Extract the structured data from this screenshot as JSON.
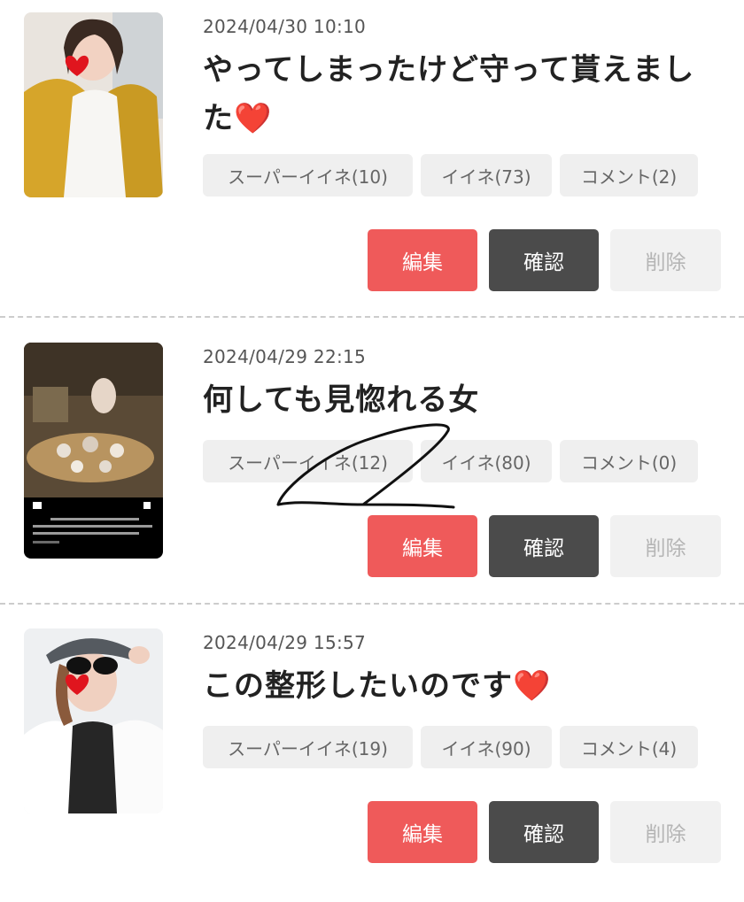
{
  "posts": [
    {
      "date": "2024/04/30 10:10",
      "title": "やってしまったけど守って貰えました",
      "title_emoji": "❤️",
      "super_like": "スーパーイイネ(10)",
      "like": "イイネ(73)",
      "comment": "コメント(2)",
      "edit_label": "編集",
      "confirm_label": "確認",
      "delete_label": "削除"
    },
    {
      "date": "2024/04/29 22:15",
      "title": "何しても見惚れる女",
      "title_emoji": "",
      "super_like": "スーパーイイネ(12)",
      "like": "イイネ(80)",
      "comment": "コメント(0)",
      "edit_label": "編集",
      "confirm_label": "確認",
      "delete_label": "削除"
    },
    {
      "date": "2024/04/29 15:57",
      "title": "この整形したいのです",
      "title_emoji": "❤️",
      "super_like": "スーパーイイネ(19)",
      "like": "イイネ(90)",
      "comment": "コメント(4)",
      "edit_label": "編集",
      "confirm_label": "確認",
      "delete_label": "削除"
    }
  ],
  "colors": {
    "edit": "#ef5a5a",
    "confirm": "#4b4b4b",
    "delete": "#f1f1f1",
    "pill": "#efefef",
    "heart": "#d8141e"
  }
}
